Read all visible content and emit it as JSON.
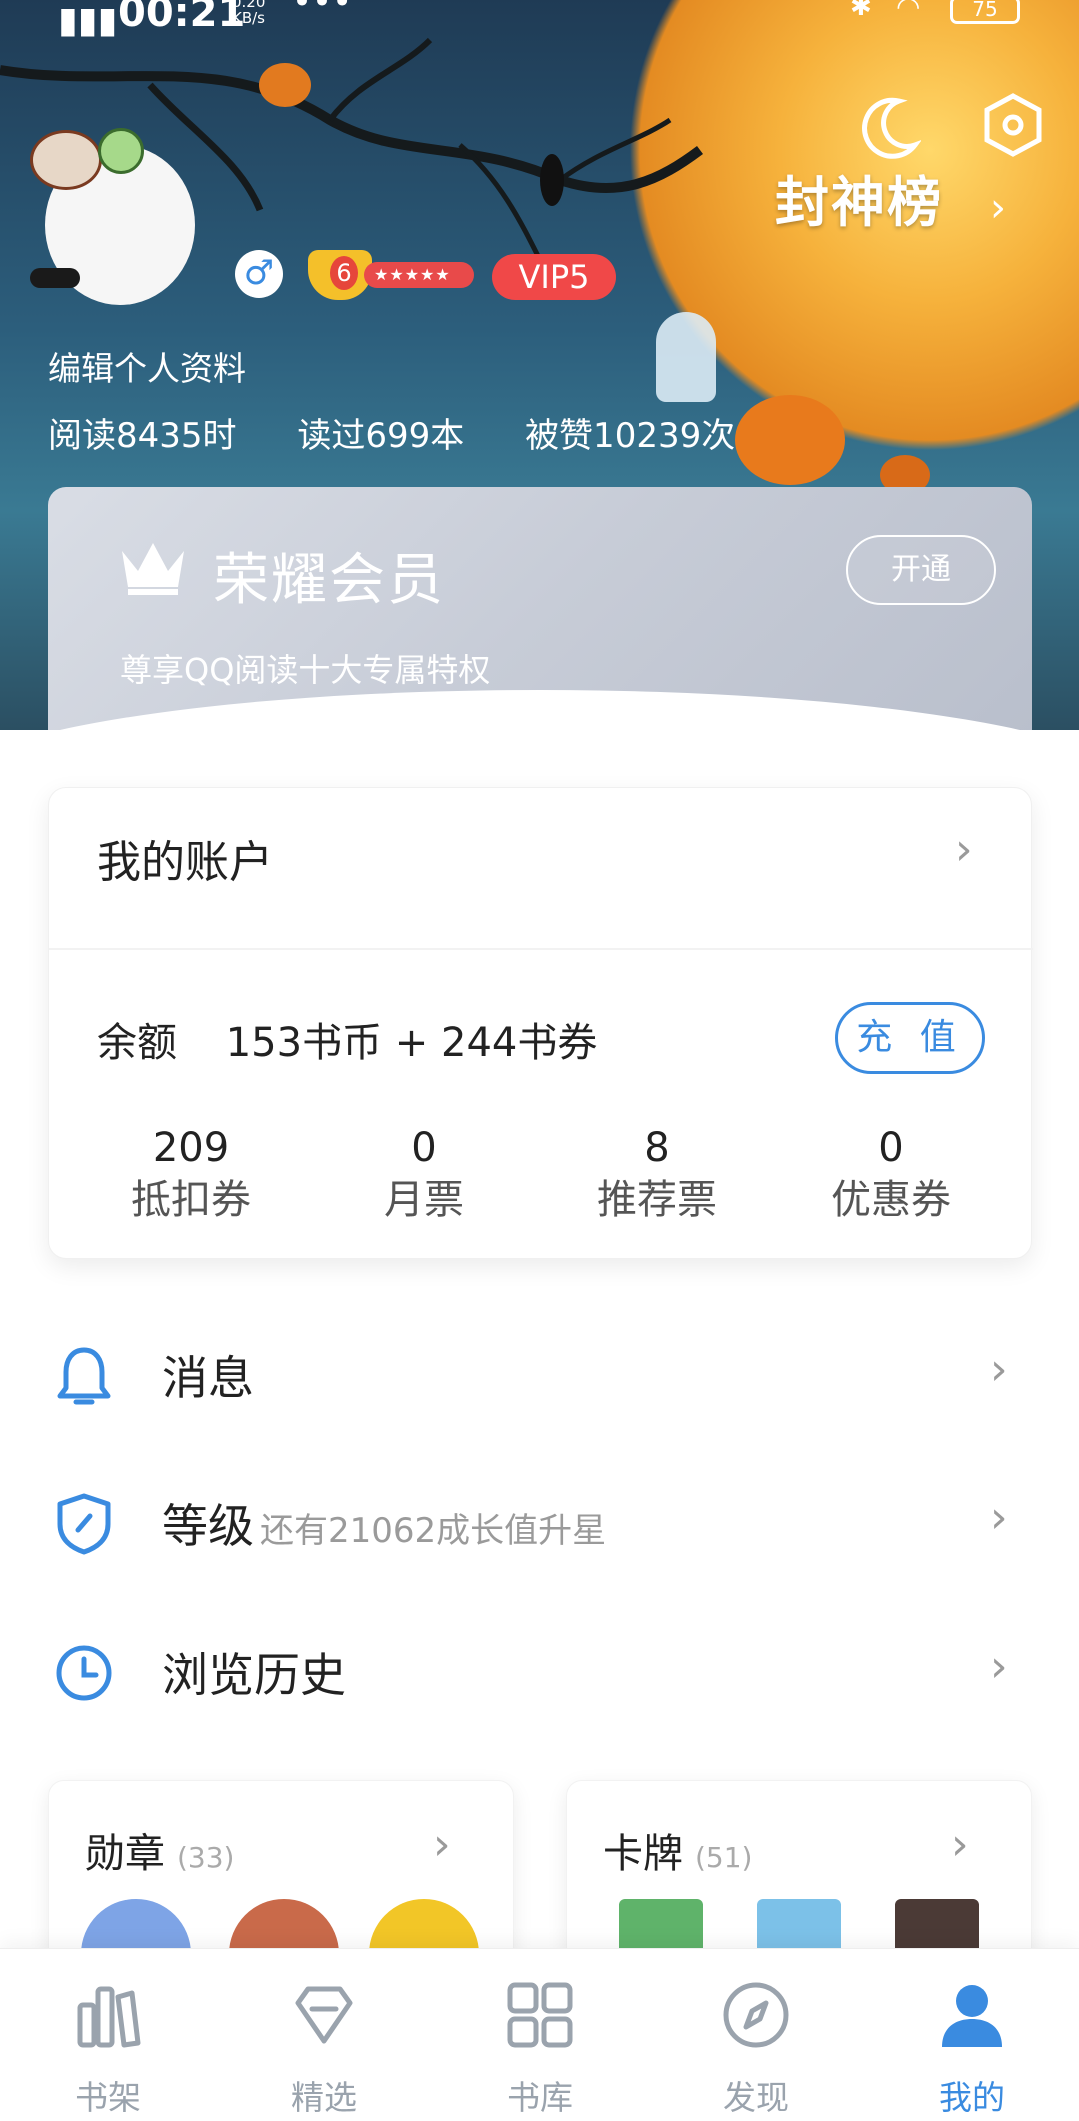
{
  "status_bar": {
    "time": "00:21",
    "net_speed": "0.20\nKB/s",
    "dots": "•••",
    "battery": "75"
  },
  "header": {
    "rank_label": "封神榜",
    "rank_chevron": "›",
    "level_number": "6",
    "level_stars": "★★★★★",
    "vip_label": "VIP5",
    "gender_symbol": "♂",
    "edit_profile": "编辑个人资料",
    "stats": [
      "阅读8435时",
      "读过699本",
      "被赞10239次"
    ]
  },
  "member": {
    "title": "荣耀会员",
    "subtitle": "尊享QQ阅读十大专属特权",
    "button": "开通"
  },
  "account": {
    "title": "我的账户",
    "balance_label": "余额",
    "balance_value": "153书币 + 244书券",
    "recharge": "充 值",
    "items": [
      {
        "value": "209",
        "label": "抵扣券"
      },
      {
        "value": "0",
        "label": "月票"
      },
      {
        "value": "8",
        "label": "推荐票"
      },
      {
        "value": "0",
        "label": "优惠券"
      }
    ]
  },
  "menu": [
    {
      "label": "消息",
      "hint": "",
      "icon": "bell-icon"
    },
    {
      "label": "等级",
      "hint": "还有21062成长值升星",
      "icon": "shield-icon"
    },
    {
      "label": "浏览历史",
      "hint": "",
      "icon": "clock-icon"
    }
  ],
  "cards": [
    {
      "title": "勋章",
      "count": "(33)"
    },
    {
      "title": "卡牌",
      "count": "(51)"
    }
  ],
  "tabs": [
    {
      "label": "书架",
      "icon": "bookshelf-icon"
    },
    {
      "label": "精选",
      "icon": "diamond-icon"
    },
    {
      "label": "书库",
      "icon": "grid-icon"
    },
    {
      "label": "发现",
      "icon": "compass-icon"
    },
    {
      "label": "我的",
      "icon": "person-icon"
    }
  ],
  "colors": {
    "accent": "#3a8be0",
    "vip": "#f04848",
    "tab_inactive": "#9aa3ad"
  }
}
